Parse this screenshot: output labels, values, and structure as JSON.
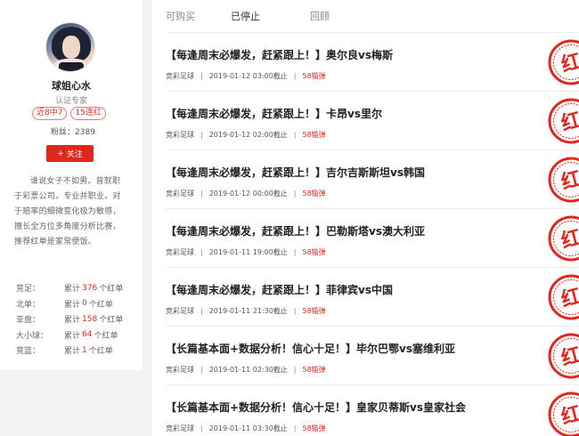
{
  "profile": {
    "name": "球姐心水",
    "verify": "认证专家",
    "badges": [
      "近8中7",
      "15连红"
    ],
    "fans_label": "粉丝：",
    "fans_count": "2389",
    "follow_label": "关注",
    "bio": "谁说女子不如男。曾就职于彩票公司，专业并职业。对于赔率的细微变化极为敏感，擅长全方位多角度分析比赛，推荐红单是家常便饭。"
  },
  "stats": [
    {
      "label": "竞足：",
      "prefix": "累计",
      "count": "376",
      "suffix": "个红单"
    },
    {
      "label": "北单：",
      "prefix": "累计",
      "count": "0",
      "suffix": "个红单"
    },
    {
      "label": "亚盘：",
      "prefix": "累计",
      "count": "158",
      "suffix": "个红单"
    },
    {
      "label": "大小球：",
      "prefix": "累计",
      "count": "64",
      "suffix": "个红单"
    },
    {
      "label": "竞篮：",
      "prefix": "累计",
      "count": "1",
      "suffix": "个红单"
    }
  ],
  "tabs": [
    {
      "label": "可购买"
    },
    {
      "label": "已停止"
    },
    {
      "label": "回顾"
    }
  ],
  "items": [
    {
      "title": "【每逢周末必爆发，赶紧跟上！】奥尔良vs梅斯",
      "category": "竞彩足球",
      "time": "2019-01-12 03:00截止",
      "price": "58猫弹"
    },
    {
      "title": "【每逢周末必爆发，赶紧跟上！】卡昂vs里尔",
      "category": "竞彩足球",
      "time": "2019-01-12 02:00截止",
      "price": "58猫弹"
    },
    {
      "title": "【每逢周末必爆发，赶紧跟上！】吉尔吉斯斯坦vs韩国",
      "category": "竞彩足球",
      "time": "2019-01-12 00:00截止",
      "price": "58猫弹"
    },
    {
      "title": "【每逢周末必爆发，赶紧跟上！】巴勒斯塔vs澳大利亚",
      "category": "竞彩足球",
      "time": "2019-01-11 19:00截止",
      "price": "58猫弹"
    },
    {
      "title": "【每逢周末必爆发，赶紧跟上！】菲律宾vs中国",
      "category": "竞彩足球",
      "time": "2019-01-11 21:30截止",
      "price": "58猫弹"
    },
    {
      "title": "【长篇基本面+数据分析！信心十足！】毕尔巴鄂vs塞维利亚",
      "category": "竞彩足球",
      "time": "2019-01-11 02:30截止",
      "price": "58猫弹"
    },
    {
      "title": "【长篇基本面+数据分析！信心十足！】皇家贝蒂斯vs皇家社会",
      "category": "竞彩足球",
      "time": "2019-01-11 03:30截止",
      "price": "58猫弹"
    }
  ],
  "stamp_text": "红",
  "colors": {
    "accent": "#e0271d",
    "background": "#f2f2f2"
  }
}
